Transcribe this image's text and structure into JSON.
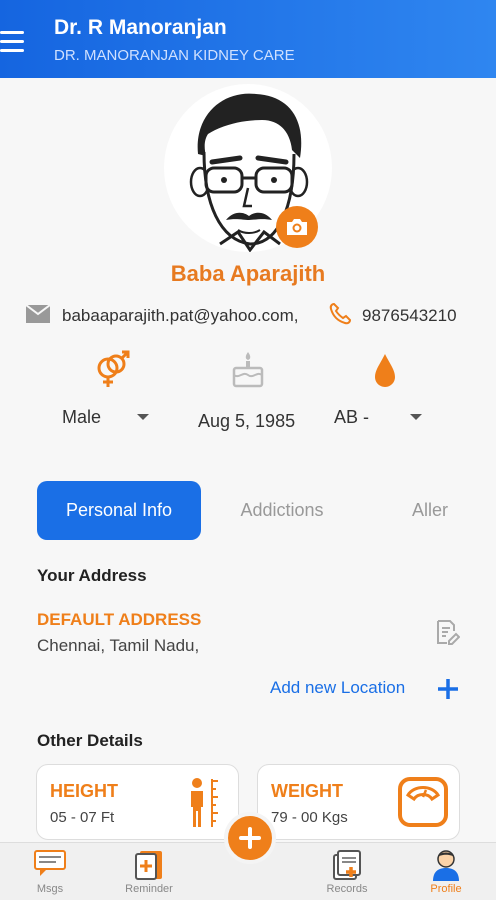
{
  "header": {
    "title": "Dr. R Manoranjan",
    "subtitle": "DR. MANORANJAN KIDNEY CARE"
  },
  "profile": {
    "name": "Baba Aparajith",
    "email": "babaaparajith.pat@yahoo.com,",
    "phone": "9876543210",
    "gender": "Male",
    "dob": "Aug 5, 1985",
    "blood_group": "AB -"
  },
  "tabs": [
    {
      "label": "Personal Info",
      "active": true
    },
    {
      "label": "Addictions",
      "active": false
    },
    {
      "label": "Aller",
      "active": false
    }
  ],
  "address": {
    "section_title": "Your Address",
    "label": "DEFAULT ADDRESS",
    "text": "Chennai, Tamil Nadu,",
    "add_location": "Add new Location"
  },
  "other_details": {
    "section_title": "Other Details",
    "height_label": "HEIGHT",
    "height_value": "05 - 07 Ft",
    "weight_label": "WEIGHT",
    "weight_value": "79 - 00 Kgs"
  },
  "bottom_nav": [
    {
      "label": "Msgs",
      "icon": "message-icon",
      "active": false
    },
    {
      "label": "Reminder",
      "icon": "reminder-icon",
      "active": false
    },
    {
      "label": "Records",
      "icon": "records-icon",
      "active": false
    },
    {
      "label": "Profile",
      "icon": "profile-icon",
      "active": true
    }
  ],
  "colors": {
    "primary_blue": "#1a6fe6",
    "accent_orange": "#ef7f1a",
    "inactive_gray": "#888888"
  }
}
